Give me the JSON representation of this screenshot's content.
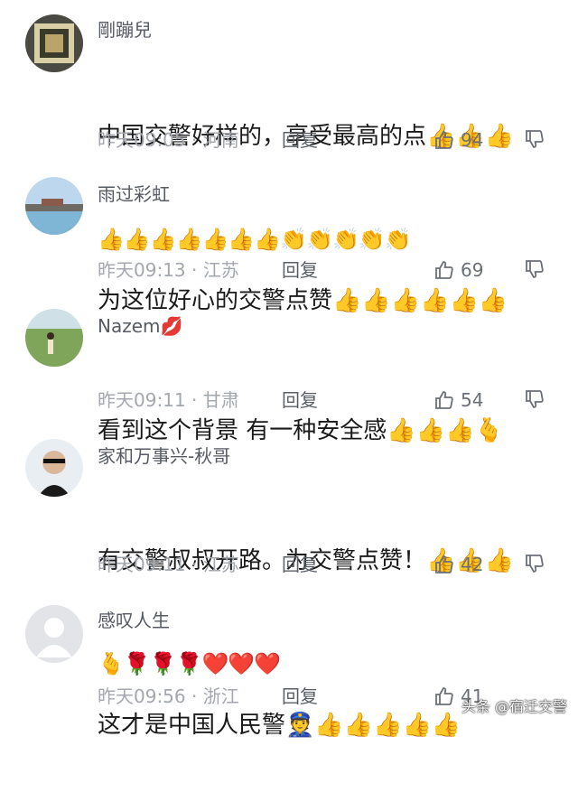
{
  "comments": [
    {
      "user": "剛蹦兒",
      "text": "中国交警好样的，享受最高的点👍👍👍",
      "text_line2": "👍👍👍👍👍👍👍👏👏👏👏👏",
      "time": "昨天09:05",
      "location": "河南",
      "reply": "回复",
      "likes": "94"
    },
    {
      "user": "雨过彩虹",
      "text": "为这位好心的交警点赞👍👍👍👍👍👍",
      "time": "昨天09:13",
      "location": "江苏",
      "reply": "回复",
      "likes": "69"
    },
    {
      "user": "Nazem💋",
      "text": "看到这个背景 有一种安全感👍👍👍🫰",
      "time": "昨天09:11",
      "location": "甘肃",
      "reply": "回复",
      "likes": "54"
    },
    {
      "user": "家和万事兴-秋哥",
      "text": "有交警叔叔开路。为交警点赞！👍👍👍",
      "text_line2": "🫰🌹🌹🌹❤️❤️❤️",
      "time": "昨天09:11",
      "location": "江苏",
      "reply": "回复",
      "likes": "42"
    },
    {
      "user": "感叹人生",
      "text": "这才是中国人民警👮👍👍👍👍👍",
      "time": "昨天09:56",
      "location": "浙江",
      "reply": "回复",
      "likes": "41"
    }
  ],
  "separator": " · ",
  "watermark": "头条 @宿迁交警",
  "icons": {
    "like": "thumbs-up-icon",
    "dislike": "thumbs-down-icon"
  }
}
